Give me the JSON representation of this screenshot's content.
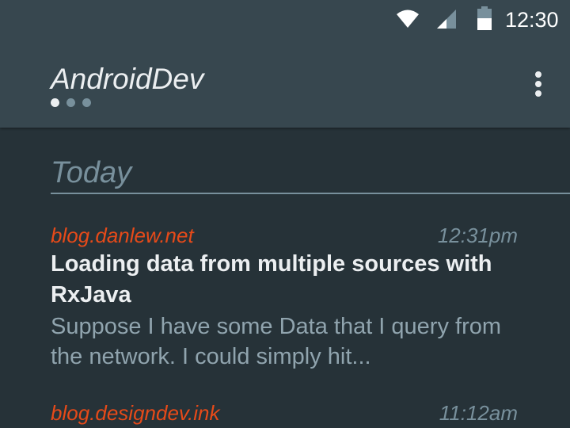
{
  "status_bar": {
    "time": "12:30",
    "icons": [
      "wifi-icon",
      "cellular-signal-icon",
      "battery-icon"
    ]
  },
  "app_bar": {
    "title": "AndroidDev",
    "page_indicator": {
      "count": 3,
      "active_index": 0
    },
    "overflow_icon": "more-vert-icon"
  },
  "feed": {
    "section_header": "Today",
    "items": [
      {
        "source": "blog.danlew.net",
        "time": "12:31pm",
        "title": "Loading data from multiple sources with RxJava",
        "summary": "Suppose I have some Data that I query from the network. I could simply hit..."
      },
      {
        "source": "blog.designdev.ink",
        "time": "11:12am"
      }
    ]
  },
  "colors": {
    "background": "#263238",
    "app_bar": "#37474f",
    "source_accent": "#e64a19",
    "muted": "#78909c",
    "title_text": "#eceff1",
    "summary_text": "#90a4ae"
  }
}
